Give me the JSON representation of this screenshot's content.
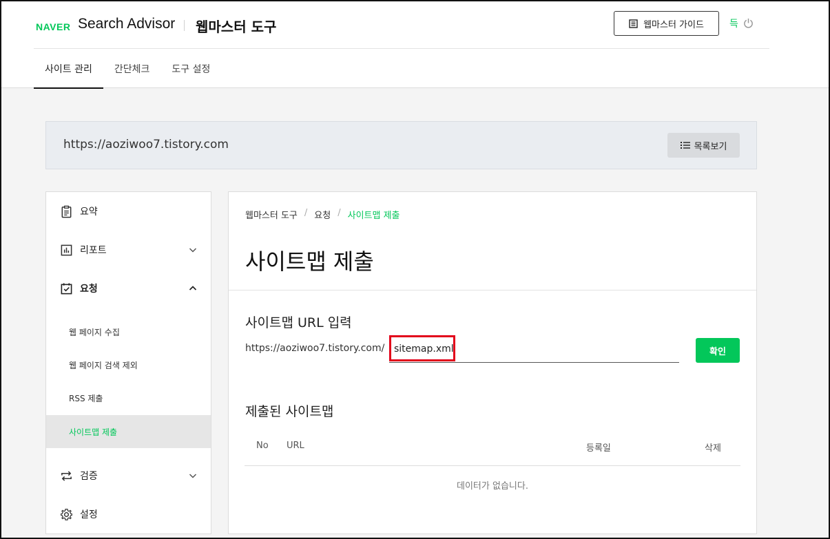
{
  "header": {
    "logo": "NAVER",
    "brand": "Search Advisor",
    "subtitle": "웹마스터 도구",
    "guide_button": "웹마스터 가이드",
    "user_name": "득"
  },
  "tabs": [
    {
      "label": "사이트 관리",
      "active": true
    },
    {
      "label": "간단체크",
      "active": false
    },
    {
      "label": "도구 설정",
      "active": false
    }
  ],
  "site": {
    "url": "https://aoziwoo7.tistory.com",
    "list_button": "목록보기"
  },
  "sidebar": {
    "items": [
      {
        "label": "요약",
        "icon": "clipboard-icon"
      },
      {
        "label": "리포트",
        "icon": "report-chart-icon",
        "expanded": false
      },
      {
        "label": "요청",
        "icon": "request-check-icon",
        "expanded": true
      },
      {
        "label": "검증",
        "icon": "verify-arrows-icon",
        "expanded": false
      },
      {
        "label": "설정",
        "icon": "gear-icon"
      }
    ],
    "sub_items": [
      {
        "label": "웹 페이지 수집",
        "active": false
      },
      {
        "label": "웹 페이지 검색 제외",
        "active": false
      },
      {
        "label": "RSS 제출",
        "active": false
      },
      {
        "label": "사이트맵 제출",
        "active": true
      }
    ]
  },
  "main": {
    "breadcrumb": [
      "웹마스터 도구",
      "요청",
      "사이트맵 제출"
    ],
    "title": "사이트맵 제출",
    "url_section_title": "사이트맵 URL 입력",
    "url_prefix": "https://aoziwoo7.tistory.com/",
    "url_value": "sitemap.xml",
    "confirm_button": "확인",
    "submitted_title": "제출된 사이트맵",
    "table_headers": {
      "no": "No",
      "url": "URL",
      "date": "등록일",
      "delete": "삭제"
    },
    "empty_message": "데이터가 없습니다."
  },
  "colors": {
    "accent": "#03c75a",
    "highlight": "#e2001a"
  }
}
